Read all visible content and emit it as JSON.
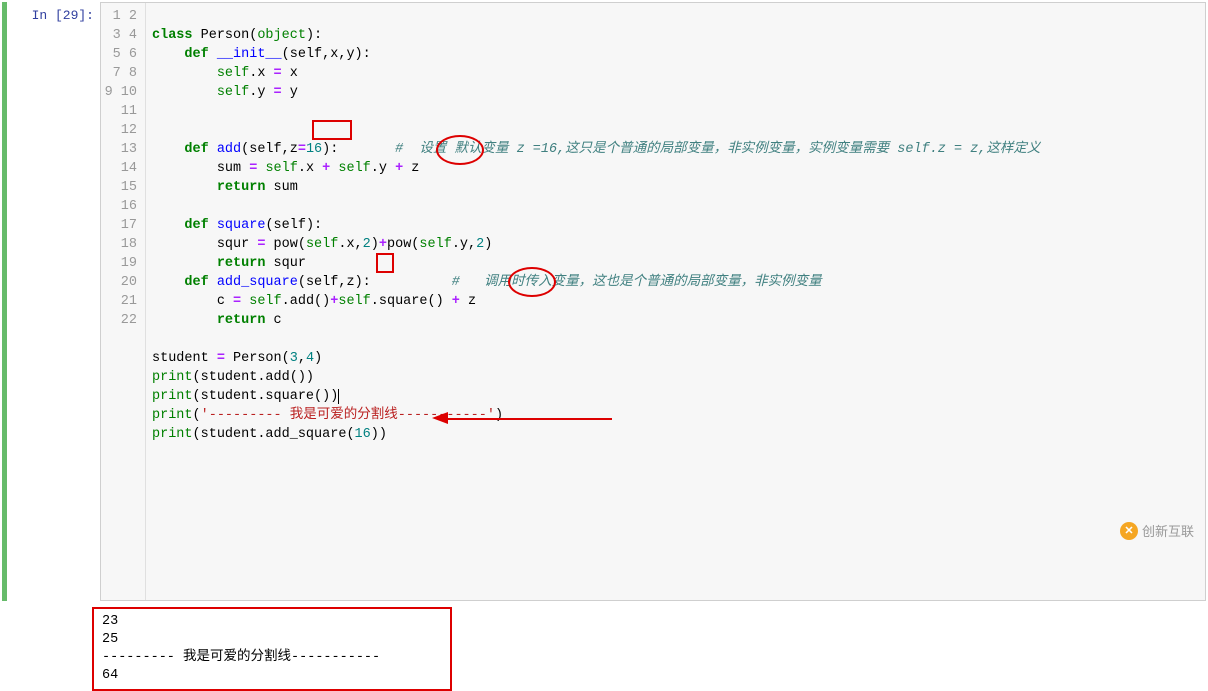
{
  "prompt": "In [29]:",
  "gutter": [
    "1",
    "2",
    "3",
    "4",
    "5",
    "6",
    "7",
    "8",
    "9",
    "10",
    "11",
    "12",
    "13",
    "14",
    "15",
    "16",
    "17",
    "18",
    "19",
    "20",
    "21",
    "22"
  ],
  "code": {
    "l1": {
      "kw1": "class",
      "tok": " Person(",
      "obj": "object",
      "rest": "):"
    },
    "l2": {
      "indent": "    ",
      "kw": "def",
      "fn": " __init__",
      "args": "(self,x,y):"
    },
    "l3": {
      "indent": "        ",
      "self": "self",
      "rest": ".x ",
      "op": "=",
      "rest2": " x"
    },
    "l4": {
      "indent": "        ",
      "self": "self",
      "rest": ".y ",
      "op": "=",
      "rest2": " y"
    },
    "l7": {
      "indent": "    ",
      "kw": "def",
      "fn": " add",
      "args": "(self,",
      "z": "z",
      "eqnum": "=16",
      "close": "):",
      "cm": "       #  设置 默认变量 z =16,这只是个普通的局部变量，非实例变量，实例变量需要 self.z = z,这样定义"
    },
    "l8": {
      "indent": "        ",
      "lhs": "sum ",
      "op": "=",
      "mid": " ",
      "self1": "self",
      "dotx": ".x ",
      "plus1": "+",
      "sp1": " ",
      "self2": "self",
      "doty": ".y ",
      "plus2": "+",
      "sp2": " z"
    },
    "l9": {
      "indent": "        ",
      "kw": "return",
      "rest": " sum"
    },
    "l11": {
      "indent": "    ",
      "kw": "def",
      "fn": " square",
      "args": "(self):"
    },
    "l12": {
      "indent": "        ",
      "lhs": "squr ",
      "op": "=",
      "rest": " pow(",
      "self1": "self",
      "r1": ".x,",
      "n1": "2",
      "r2": ")",
      "plus": "+",
      "r3": "pow(",
      "self2": "self",
      "r4": ".y,",
      "n2": "2",
      "r5": ")"
    },
    "l13": {
      "indent": "        ",
      "kw": "return",
      "rest": " squr"
    },
    "l14": {
      "indent": "    ",
      "kw": "def",
      "fn": " add_square",
      "args": "(self,",
      "z": "z",
      "close": "):",
      "cm": "          #   调用时传入变量，这也是个普通的局部变量，非实例变量"
    },
    "l15": {
      "indent": "        ",
      "lhs": "c ",
      "op": "=",
      "sp": " ",
      "self1": "self",
      "r1": ".add()",
      "plus1": "+",
      "self2": "self",
      "r2": ".square() ",
      "plus2": "+",
      "tail": " z"
    },
    "l16": {
      "indent": "        ",
      "kw": "return",
      "rest": " c"
    },
    "l18": {
      "lhs": "student ",
      "op": "=",
      "rest": " Person(",
      "n1": "3",
      "c": ",",
      "n2": "4",
      "close": ")"
    },
    "l19": {
      "p": "print",
      "open": "(student.add())"
    },
    "l20": {
      "p": "print",
      "open": "(student.square())"
    },
    "l21": {
      "p": "print",
      "open": "(",
      "str": "'--------- 我是可爱的分割线-----------'",
      "close": ")"
    },
    "l22": {
      "p": "print",
      "open": "(student.add_square(",
      "n": "16",
      "close": "))"
    }
  },
  "output": {
    "l1": "23",
    "l2": "25",
    "l3": "--------- 我是可爱的分割线-----------",
    "l4": "64"
  },
  "watermark": "创新互联"
}
